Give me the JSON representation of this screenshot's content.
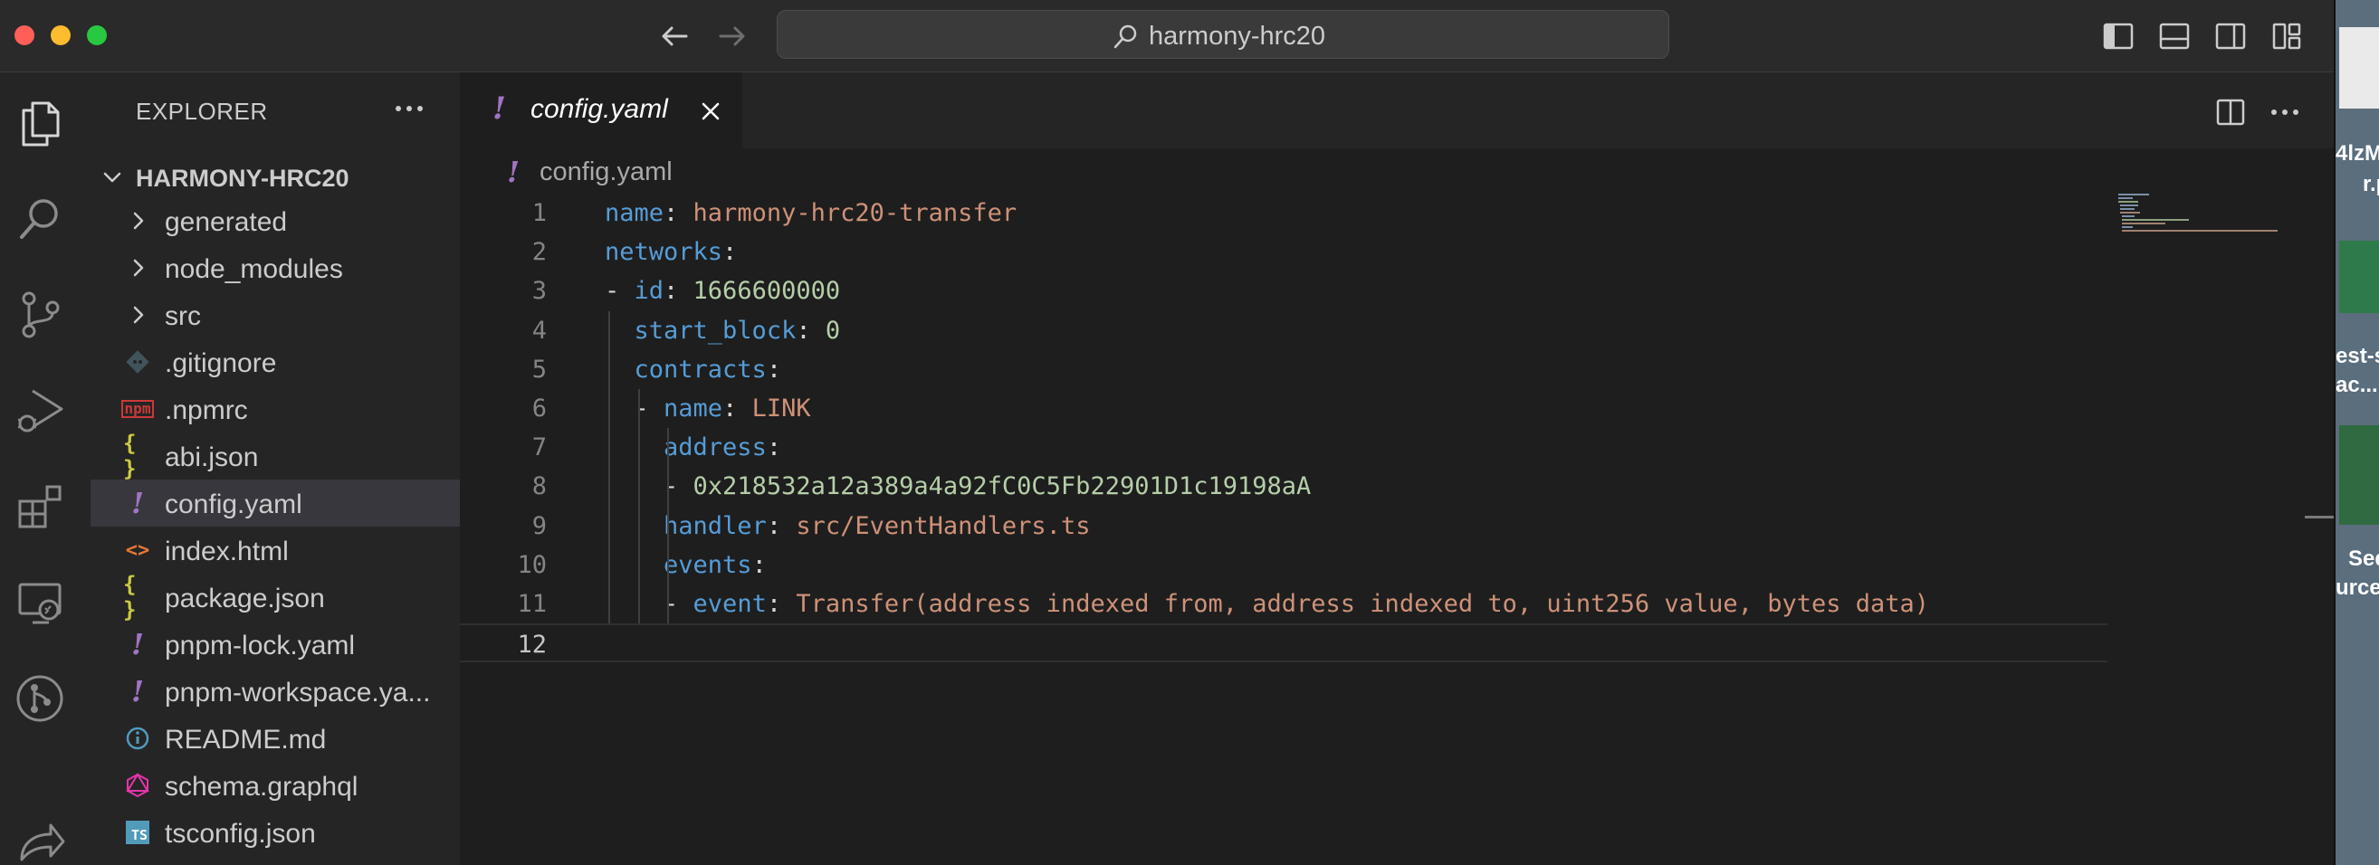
{
  "window": {
    "search_title": "harmony-hrc20"
  },
  "sidebar": {
    "title": "EXPLORER",
    "workspace": "HARMONY-HRC20",
    "items": [
      {
        "label": "generated",
        "kind": "folder",
        "icon": "chevron-right-icon"
      },
      {
        "label": "node_modules",
        "kind": "folder",
        "icon": "chevron-right-icon"
      },
      {
        "label": "src",
        "kind": "folder",
        "icon": "chevron-right-icon"
      },
      {
        "label": ".gitignore",
        "kind": "file",
        "icon": "git-icon"
      },
      {
        "label": ".npmrc",
        "kind": "file",
        "icon": "npm-icon"
      },
      {
        "label": "abi.json",
        "kind": "file",
        "icon": "json-icon"
      },
      {
        "label": "config.yaml",
        "kind": "file",
        "icon": "yaml-icon",
        "selected": true
      },
      {
        "label": "index.html",
        "kind": "file",
        "icon": "html-icon"
      },
      {
        "label": "package.json",
        "kind": "file",
        "icon": "json-icon"
      },
      {
        "label": "pnpm-lock.yaml",
        "kind": "file",
        "icon": "yaml-icon"
      },
      {
        "label": "pnpm-workspace.ya...",
        "kind": "file",
        "icon": "yaml-icon"
      },
      {
        "label": "README.md",
        "kind": "file",
        "icon": "info-icon"
      },
      {
        "label": "schema.graphql",
        "kind": "file",
        "icon": "graphql-icon"
      },
      {
        "label": "tsconfig.json",
        "kind": "file",
        "icon": "typescript-icon"
      }
    ],
    "icon_glyphs": {
      "json": "{ }",
      "yaml": "!",
      "html": "<>",
      "ts": "TS",
      "npm": "npm"
    }
  },
  "editor": {
    "tab_label": "config.yaml",
    "tab_icon_glyph": "!",
    "breadcrumb": "config.yaml",
    "lines": [
      {
        "num": "1",
        "key": "name",
        "sep": ": ",
        "value": "harmony-hrc20-transfer",
        "vtype": "s"
      },
      {
        "num": "2",
        "key": "networks",
        "sep": ":"
      },
      {
        "num": "3",
        "dash": "- ",
        "key": "id",
        "sep": ": ",
        "value": "1666600000",
        "vtype": "n"
      },
      {
        "num": "4",
        "indent": "  ",
        "key": "start_block",
        "sep": ": ",
        "value": "0",
        "vtype": "n"
      },
      {
        "num": "5",
        "indent": "  ",
        "key": "contracts",
        "sep": ":"
      },
      {
        "num": "6",
        "indent": "  ",
        "dash": "- ",
        "key": "name",
        "sep": ": ",
        "value": "LINK",
        "vtype": "s"
      },
      {
        "num": "7",
        "indent": "    ",
        "key": "address",
        "sep": ":"
      },
      {
        "num": "8",
        "indent": "    ",
        "dash": "- ",
        "value": "0x218532a12a389a4a92fC0C5Fb22901D1c19198aA",
        "vtype": "n"
      },
      {
        "num": "9",
        "indent": "    ",
        "key": "handler",
        "sep": ": ",
        "value": "src/EventHandlers.ts",
        "vtype": "s"
      },
      {
        "num": "10",
        "indent": "    ",
        "key": "events",
        "sep": ":"
      },
      {
        "num": "11",
        "indent": "    ",
        "dash": "- ",
        "key": "event",
        "sep": ": ",
        "value": "Transfer(address indexed from, address indexed to, uint256 value, bytes data)",
        "vtype": "s"
      },
      {
        "num": "12",
        "current": true
      }
    ]
  },
  "desktop": {
    "snippets": [
      "4lzM",
      "r.p",
      "est-s",
      "ac...l",
      "Seq",
      "urce"
    ]
  },
  "colors": {
    "keyword": "#569cd6",
    "string": "#ce9178",
    "number": "#b5cea8",
    "yaml_icon": "#a074c4",
    "json_icon": "#cbcb41",
    "html_icon": "#e37933",
    "npm_icon": "#cb3837",
    "info_icon": "#519aba",
    "graphql_icon": "#e535ab",
    "ts_icon": "#519aba"
  }
}
